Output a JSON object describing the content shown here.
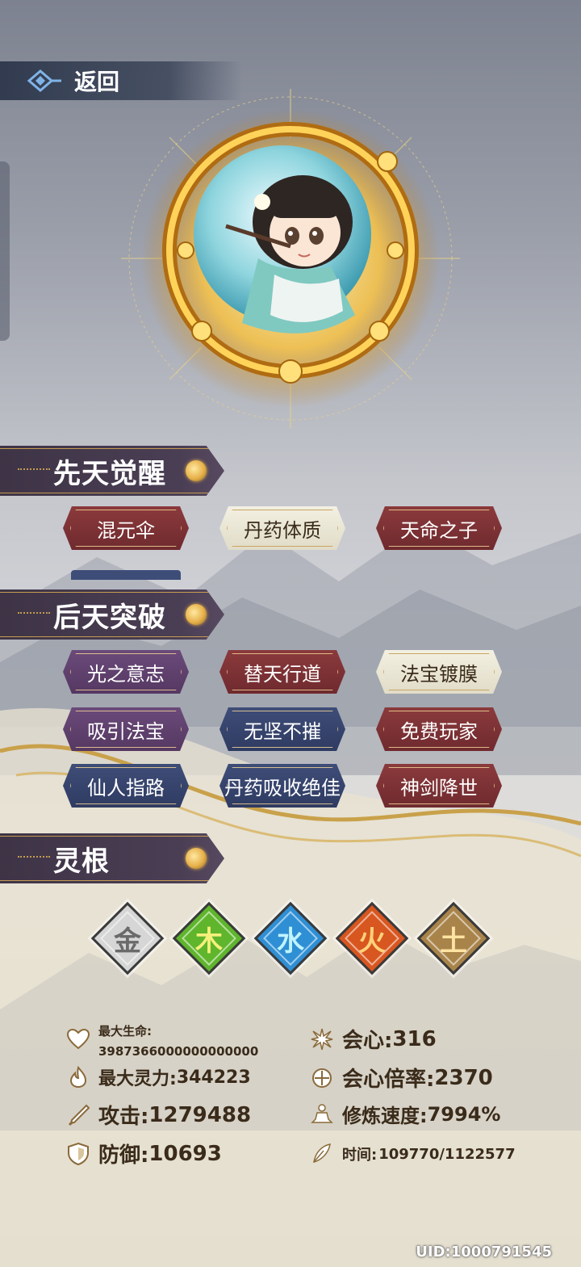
{
  "header": {
    "back_label": "返回"
  },
  "sections": {
    "innate": {
      "title": "先天觉醒",
      "tags": [
        {
          "label": "混元伞",
          "style": "red"
        },
        {
          "label": "丹药体质",
          "style": "white"
        },
        {
          "label": "天命之子",
          "style": "red"
        }
      ]
    },
    "acquired": {
      "title": "后天突破",
      "tags": [
        {
          "label": "光之意志",
          "style": "purple"
        },
        {
          "label": "替天行道",
          "style": "red"
        },
        {
          "label": "法宝镀膜",
          "style": "white"
        },
        {
          "label": "吸引法宝",
          "style": "purple"
        },
        {
          "label": "无坚不摧",
          "style": "blue"
        },
        {
          "label": "免费玩家",
          "style": "red"
        },
        {
          "label": "仙人指路",
          "style": "blue"
        },
        {
          "label": "丹药吸收绝佳",
          "style": "blue"
        },
        {
          "label": "神剑降世",
          "style": "red"
        }
      ]
    },
    "roots": {
      "title": "灵根",
      "elements": [
        {
          "glyph": "金",
          "color": "#d6d6d6",
          "text": "#6a6a6a"
        },
        {
          "glyph": "木",
          "color": "#7ccf3a",
          "text": "#f5f07a"
        },
        {
          "glyph": "水",
          "color": "#3aa6e6",
          "text": "#bff3ff"
        },
        {
          "glyph": "火",
          "color": "#e5642a",
          "text": "#ffd17a"
        },
        {
          "glyph": "土",
          "color": "#b8945a",
          "text": "#ffe3a2"
        }
      ]
    }
  },
  "stats": {
    "max_hp": {
      "label": "最大生命:",
      "value": "3987366000000000000"
    },
    "max_mp": {
      "label": "最大灵力:",
      "value": "344223"
    },
    "attack": {
      "label": "攻击:",
      "value": "1279488"
    },
    "defense": {
      "label": "防御:",
      "value": "10693"
    },
    "crit": {
      "label": "会心:",
      "value": "316"
    },
    "crit_mult": {
      "label": "会心倍率:",
      "value": "2370"
    },
    "cultivation_speed": {
      "label": "修炼速度:",
      "value": "7994%"
    },
    "time": {
      "label": "时间:",
      "value": "109770/1122577"
    }
  },
  "uid": "UID:1000791545"
}
